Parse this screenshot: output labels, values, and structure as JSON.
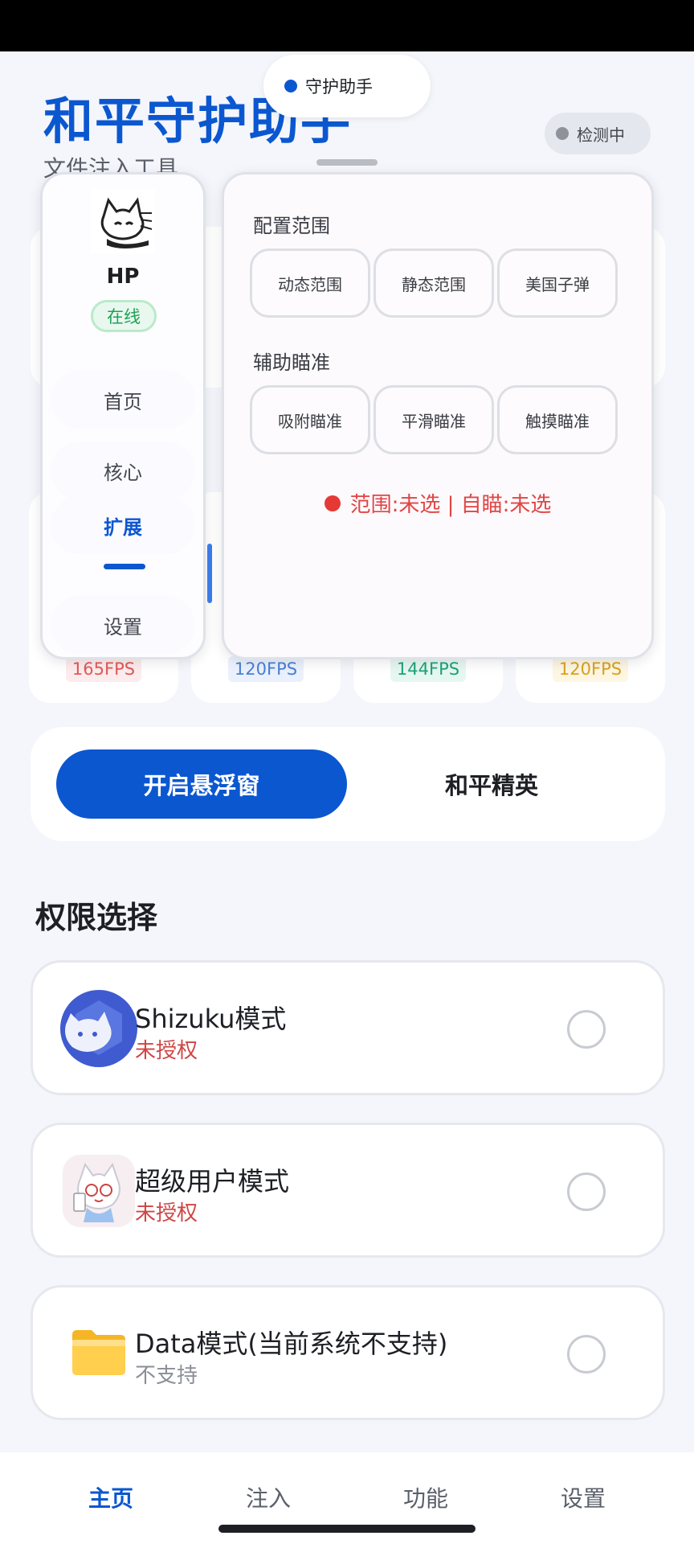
{
  "app": {
    "title": "和平守护助手",
    "subtitle": "文件注入工具",
    "detect_status": "检测中",
    "helper_pill": "守护助手"
  },
  "fps_tags": [
    {
      "label": "165FPS",
      "color": "#e05a5a",
      "bg": "#fdeced"
    },
    {
      "label": "120FPS",
      "color": "#4a7fd6",
      "bg": "#eaf1fc"
    },
    {
      "label": "144FPS",
      "color": "#1fa27a",
      "bg": "#e6f7f1"
    },
    {
      "label": "120FPS",
      "color": "#d8a21e",
      "bg": "#fdf6e3"
    }
  ],
  "float_menu": {
    "user_name": "HP",
    "online": "在线",
    "nav": [
      "首页",
      "核心",
      "扩展",
      "设置"
    ],
    "active_nav": "扩展"
  },
  "float_panel": {
    "range_section": "配置范围",
    "range_options": [
      "动态范围",
      "静态范围",
      "美国子弹"
    ],
    "aim_section": "辅助瞄准",
    "aim_options": [
      "吸附瞄准",
      "平滑瞄准",
      "触摸瞄准"
    ],
    "status": "范围:未选 | 自瞄:未选"
  },
  "actions": {
    "primary": "开启悬浮窗",
    "secondary": "和平精英"
  },
  "permissions": {
    "title": "权限选择",
    "items": [
      {
        "name": "Shizuku模式",
        "status": "未授权",
        "status_color": "#d04545",
        "icon": "shizuku-cat-icon"
      },
      {
        "name": "超级用户模式",
        "status": "未授权",
        "status_color": "#d04545",
        "icon": "anime-avatar-icon"
      },
      {
        "name": "Data模式(当前系统不支持)",
        "status": "不支持",
        "status_color": "#8a8e96",
        "icon": "folder-icon"
      }
    ]
  },
  "bottom_nav": [
    "主页",
    "注入",
    "功能",
    "设置"
  ],
  "colors": {
    "accent": "#0b57d0",
    "danger": "#e53935",
    "success": "#1fa255"
  }
}
